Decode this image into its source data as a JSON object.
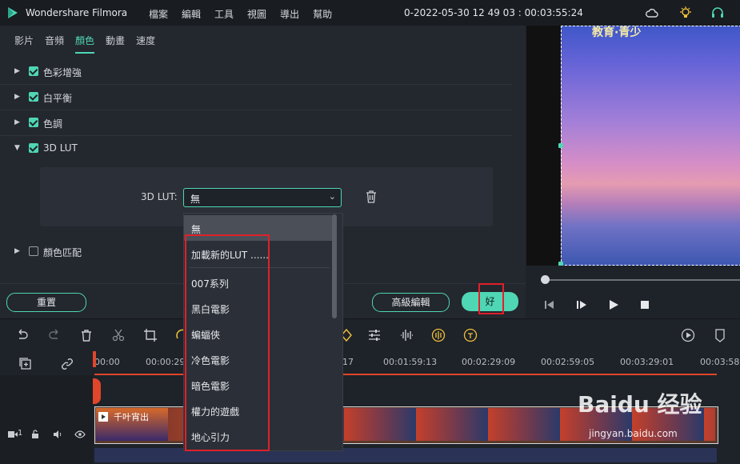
{
  "app": {
    "name": "Wondershare Filmora",
    "menu": [
      "檔案",
      "編輯",
      "工具",
      "視圖",
      "導出",
      "幫助"
    ],
    "project_title": "0-2022-05-30 12 49 03 : 00:03:55:24"
  },
  "color_panel": {
    "tabs": [
      "影片",
      "音頻",
      "顏色",
      "動畫",
      "速度"
    ],
    "active_tab": "顏色",
    "sections": [
      {
        "label": "色彩增強",
        "checked": true,
        "expanded": false
      },
      {
        "label": "白平衡",
        "checked": true,
        "expanded": false
      },
      {
        "label": "色調",
        "checked": true,
        "expanded": false
      },
      {
        "label": "3D LUT",
        "checked": true,
        "expanded": true
      },
      {
        "label": "顏色匹配",
        "checked": false,
        "expanded": false
      }
    ],
    "lut_label": "3D LUT:",
    "lut_value": "無",
    "reset_button": "重置",
    "advanced_button": "高級編輯",
    "ok_button": "好"
  },
  "lut_dropdown": {
    "options": [
      "無",
      "加載新的LUT ......",
      "007系列",
      "黑白電影",
      "蝙蝠俠",
      "冷色電影",
      "暗色電影",
      "權力的遊戲",
      "地心引力"
    ],
    "selected": "無"
  },
  "preview": {
    "video_caption": "教育·青少"
  },
  "timeline": {
    "ticks": [
      "00:00",
      "00:00:29",
      "17",
      "00:01:59:13",
      "00:02:29:09",
      "00:02:59:05",
      "00:03:29:01",
      "00:03:58"
    ],
    "track_label": "1",
    "clip_label": "千叶宵出"
  },
  "watermark": {
    "text": "Baidu 经验",
    "url": "jingyan.baidu.com"
  },
  "colors": {
    "accent": "#4fd6b4",
    "highlight": "#e0202a",
    "background": "#1e2229"
  }
}
